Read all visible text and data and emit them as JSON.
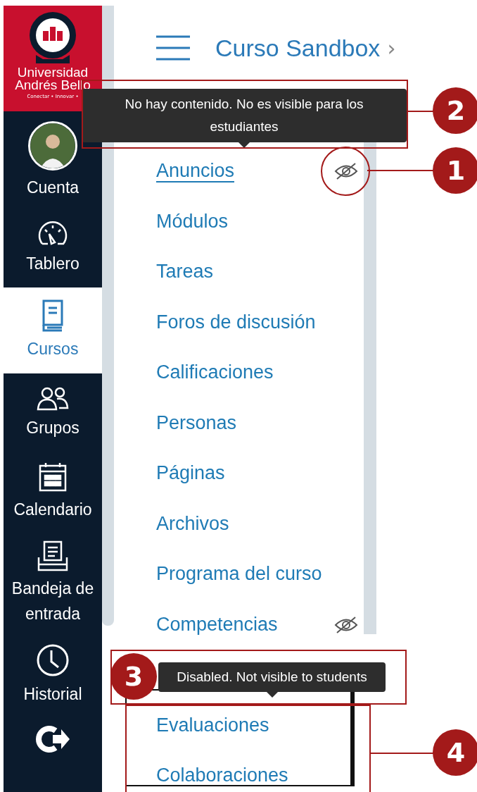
{
  "sidebar": {
    "logo": {
      "name_lines": [
        "Universidad",
        "Andrés Bello"
      ],
      "tagline": "Conectar • Innovar •"
    },
    "items": [
      {
        "kind": "account",
        "label": "Cuenta",
        "selected": false
      },
      {
        "kind": "dashboard",
        "label": "Tablero",
        "selected": false
      },
      {
        "kind": "courses",
        "label": "Cursos",
        "selected": true
      },
      {
        "kind": "groups",
        "label": "Grupos",
        "selected": false
      },
      {
        "kind": "calendar",
        "label": "Calendario",
        "selected": false
      },
      {
        "kind": "inbox",
        "label": "Bandeja de entrada",
        "selected": false
      },
      {
        "kind": "history",
        "label": "Historial",
        "selected": false
      },
      {
        "kind": "logout",
        "selected": false
      }
    ]
  },
  "header": {
    "course_title": "Curso Sandbox",
    "chevron": "›"
  },
  "course_menu": [
    {
      "kind": "covered"
    },
    {
      "kind": "link",
      "label": "Anuncios",
      "hidden": true,
      "focused": true
    },
    {
      "kind": "link",
      "label": "Módulos",
      "hidden": false,
      "focused": false
    },
    {
      "kind": "link",
      "label": "Tareas",
      "hidden": false,
      "focused": false
    },
    {
      "kind": "link",
      "label": "Foros de discusión",
      "hidden": false,
      "focused": false
    },
    {
      "kind": "link",
      "label": "Calificaciones",
      "hidden": false,
      "focused": false
    },
    {
      "kind": "link",
      "label": "Personas",
      "hidden": false,
      "focused": false
    },
    {
      "kind": "link",
      "label": "Páginas",
      "hidden": false,
      "focused": false
    },
    {
      "kind": "link",
      "label": "Archivos",
      "hidden": false,
      "focused": false
    },
    {
      "kind": "link",
      "label": "Programa del curso",
      "hidden": false,
      "focused": false
    },
    {
      "kind": "link",
      "label": "Competencias",
      "hidden": true,
      "focused": false
    },
    {
      "kind": "covered"
    },
    {
      "kind": "link",
      "label": "Evaluaciones",
      "hidden": false,
      "focused": false
    },
    {
      "kind": "link",
      "label": "Colaboraciones",
      "hidden": false,
      "focused": false
    }
  ],
  "tooltips": [
    "No hay contenido. No es visible para los estudiantes",
    "Disabled. Not visible to students"
  ],
  "callouts": [
    "2",
    "1",
    "3",
    "4"
  ]
}
